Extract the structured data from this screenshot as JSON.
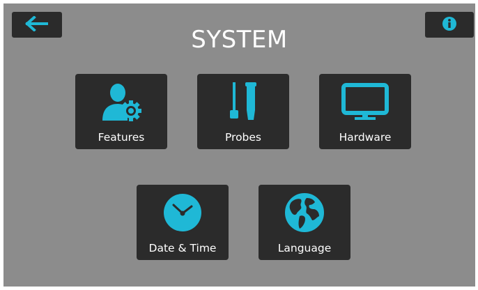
{
  "title": "SYSTEM",
  "colors": {
    "accent": "#1fb8d6",
    "tile": "#2b2b2b",
    "background": "#8c8c8c"
  },
  "header": {
    "back_icon": "arrow-left-icon",
    "info_icon": "info-icon"
  },
  "tiles": [
    {
      "label": "Features",
      "icon": "user-gear-icon"
    },
    {
      "label": "Probes",
      "icon": "probes-icon"
    },
    {
      "label": "Hardware",
      "icon": "monitor-icon"
    },
    {
      "label": "Date & Time",
      "icon": "clock-icon"
    },
    {
      "label": "Language",
      "icon": "globe-icon"
    }
  ]
}
